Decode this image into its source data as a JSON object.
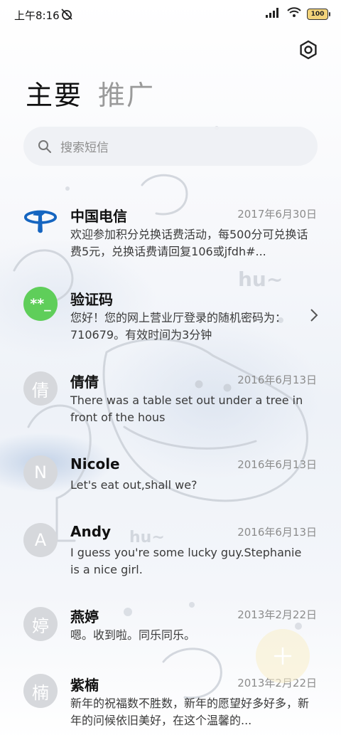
{
  "status_bar": {
    "time": "上午8:16",
    "battery": "100"
  },
  "tabs": [
    {
      "label": "主要",
      "active": true
    },
    {
      "label": "推广",
      "active": false
    }
  ],
  "search": {
    "placeholder": "搜索短信"
  },
  "conversations": [
    {
      "name": "中国电信",
      "avatar": "telecom-logo",
      "date": "2017年6月30日",
      "snippet": "欢迎参加积分兑换话费活动，每500分可兑换话费5元，兑换话费请回复106或jfdh#..."
    },
    {
      "name": "验证码",
      "avatar_text": "**_",
      "date": "",
      "snippet": "您好！您的网上营业厅登录的随机密码为：710679。有效时间为3分钟"
    },
    {
      "name": "倩倩",
      "avatar_text": "倩",
      "date": "2016年6月13日",
      "snippet": "There was a table set out under a tree in front of the hous"
    },
    {
      "name": "Nicole",
      "avatar_text": "N",
      "date": "2016年6月13日",
      "snippet": "Let's eat out,shall we?"
    },
    {
      "name": "Andy",
      "avatar_text": "A",
      "date": "2016年6月13日",
      "snippet": "I guess you're some lucky guy.Stephanie is a nice girl."
    },
    {
      "name": "燕婷",
      "avatar_text": "婷",
      "date": "2013年2月22日",
      "snippet": "嗯。收到啦。同乐同乐。"
    },
    {
      "name": "紫楠",
      "avatar_text": "楠",
      "date": "2013年2月22日",
      "snippet": "新年的祝福数不胜数，新年的愿望好多好多，新年的问候依旧美好，在这个温馨的..."
    }
  ],
  "background_art_text": "hu~",
  "colors": {
    "accent_green": "#5fce5a",
    "telecom_blue": "#1565c0",
    "inactive_tab": "#9a9a9a"
  }
}
